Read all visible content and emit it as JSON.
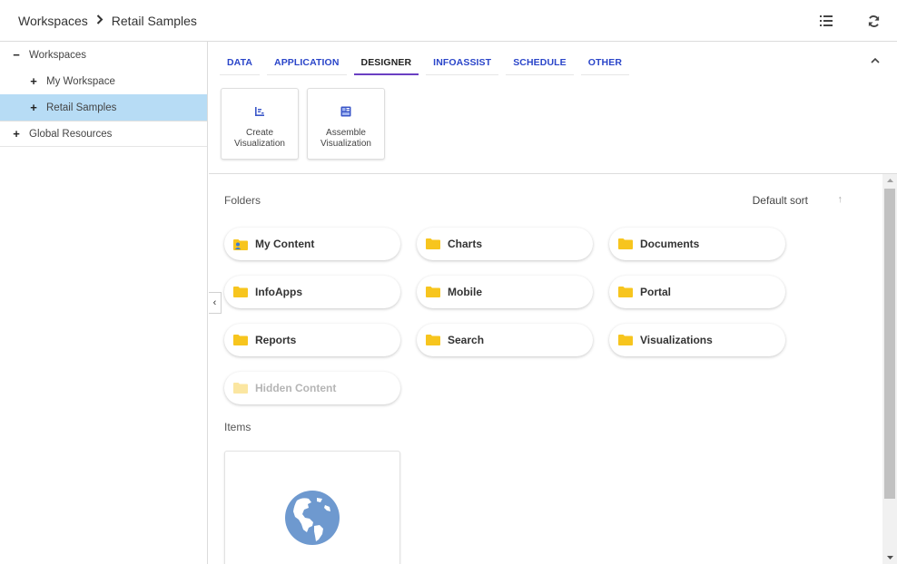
{
  "breadcrumb": {
    "root": "Workspaces",
    "current": "Retail Samples"
  },
  "header_actions": {
    "list_view_icon": "list-view-icon",
    "refresh_icon": "refresh-icon"
  },
  "tree": {
    "workspaces": {
      "sign": "−",
      "label": "Workspaces"
    },
    "my_workspace": {
      "sign": "+",
      "label": "My Workspace"
    },
    "retail_samples": {
      "sign": "+",
      "label": "Retail Samples"
    },
    "global_resources": {
      "sign": "+",
      "label": "Global Resources"
    }
  },
  "ribbon": {
    "tabs": [
      "DATA",
      "APPLICATION",
      "DESIGNER",
      "INFOASSIST",
      "SCHEDULE",
      "OTHER"
    ],
    "active_tab": "DESIGNER",
    "tools": [
      {
        "line1": "Create",
        "line2": "Visualization",
        "icon": "create-visualization-icon"
      },
      {
        "line1": "Assemble",
        "line2": "Visualization",
        "icon": "assemble-visualization-icon"
      }
    ]
  },
  "content": {
    "folders_title": "Folders",
    "sort_label": "Default sort",
    "sort_arrow": "↑",
    "folders": [
      "My Content",
      "Charts",
      "Documents",
      "InfoApps",
      "Mobile",
      "Portal",
      "Reports",
      "Search",
      "Visualizations",
      "Hidden Content"
    ],
    "items_title": "Items"
  },
  "side_toggle": "‹",
  "colors": {
    "accent_blue": "#2a45c9",
    "active_tab_underline": "#6a3fc2",
    "selected_row": "#b7dcf5",
    "folder_yellow": "#f7c51e",
    "globe_blue": "#6e99cf"
  }
}
